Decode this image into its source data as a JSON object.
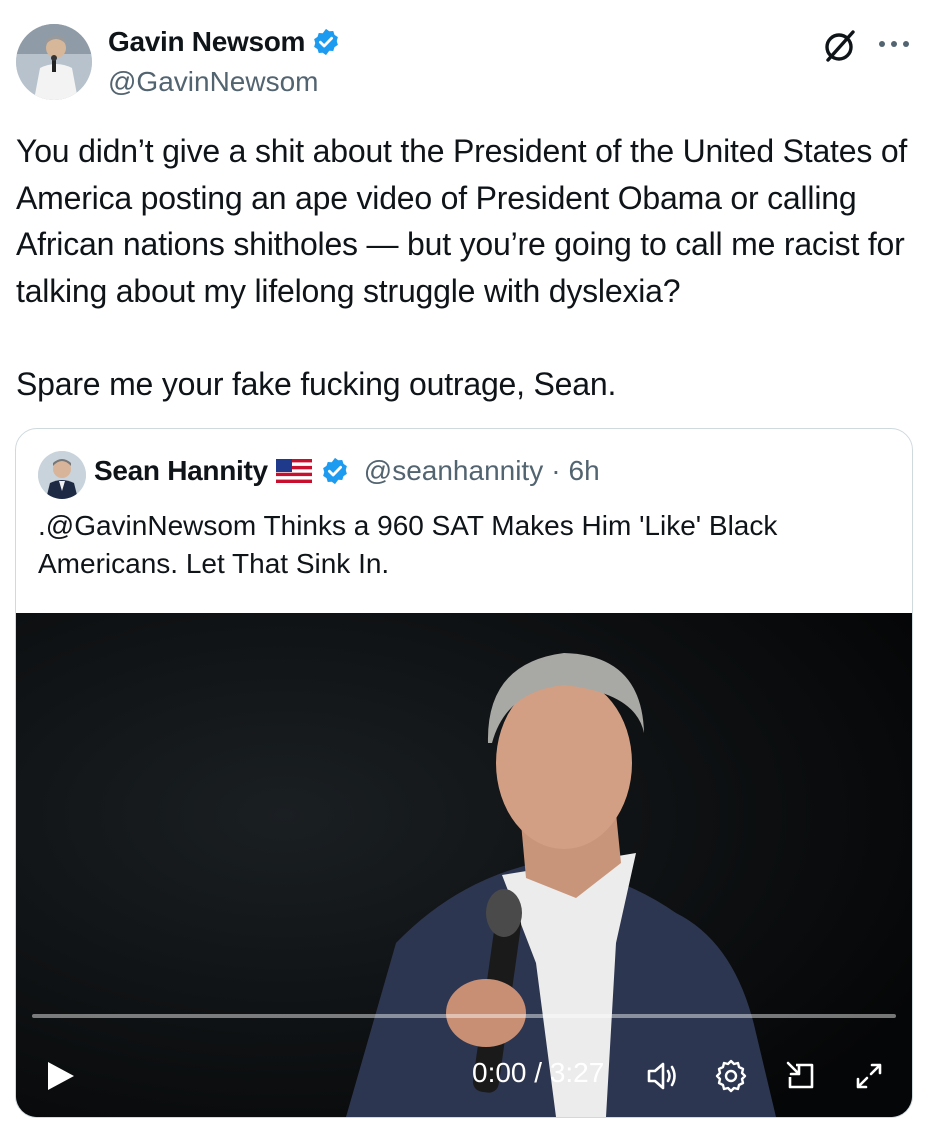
{
  "post": {
    "author": {
      "name": "Gavin Newsom",
      "handle": "@GavinNewsom",
      "verified": true,
      "avatar_icon": "person-photo-icon"
    },
    "text": "You didn’t give a shit about the President of the United States of America posting an ape video of President Obama or calling African nations shitholes — but you’re going  to call me racist for talking about my lifelong struggle with dyslexia?\n\nSpare me your fake fucking outrage, Sean.",
    "top_icons": [
      "grok-icon",
      "more-icon"
    ]
  },
  "quote": {
    "author": {
      "name": "Sean Hannity",
      "flag": "us-flag-icon",
      "verified": true,
      "handle": "@seanhannity",
      "separator": "·",
      "time": "6h"
    },
    "text": ".@GavinNewsom  Thinks a 960 SAT Makes Him 'Like' Black Americans. Let That Sink In.",
    "video": {
      "current_time": "0:00",
      "duration": "3:27",
      "time_display": "0:00 / 3:27",
      "progress": 0,
      "controls": [
        "play-icon",
        "volume-icon",
        "settings-icon",
        "pip-icon",
        "fullscreen-icon"
      ]
    }
  },
  "colors": {
    "text": "#0f1419",
    "secondary": "#536471",
    "verified_blue": "#1d9bf0",
    "border": "#cfd9de",
    "video_bg": "#000000"
  }
}
